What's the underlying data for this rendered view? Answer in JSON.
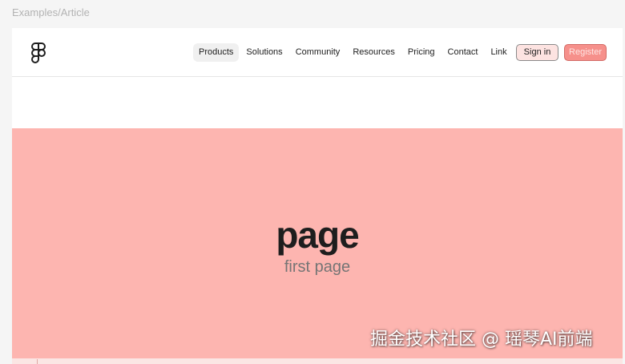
{
  "frame_label": "Examples/Article",
  "header": {
    "logo_icon": "figma-logo-icon",
    "nav_items": [
      {
        "label": "Products",
        "active": true
      },
      {
        "label": "Solutions",
        "active": false
      },
      {
        "label": "Community",
        "active": false
      },
      {
        "label": "Resources",
        "active": false
      },
      {
        "label": "Pricing",
        "active": false
      },
      {
        "label": "Contact",
        "active": false
      },
      {
        "label": "Link",
        "active": false
      }
    ],
    "sign_in_label": "Sign in",
    "register_label": "Register"
  },
  "hero": {
    "title": "page",
    "subtitle": "first page"
  },
  "watermark": "掘金技术社区 @ 瑶琴AI前端",
  "colors": {
    "hero_background": "#fdb5b0",
    "register_background": "#f6908b",
    "sign_in_background": "#fde3e1",
    "page_background": "#f5f5f5"
  }
}
